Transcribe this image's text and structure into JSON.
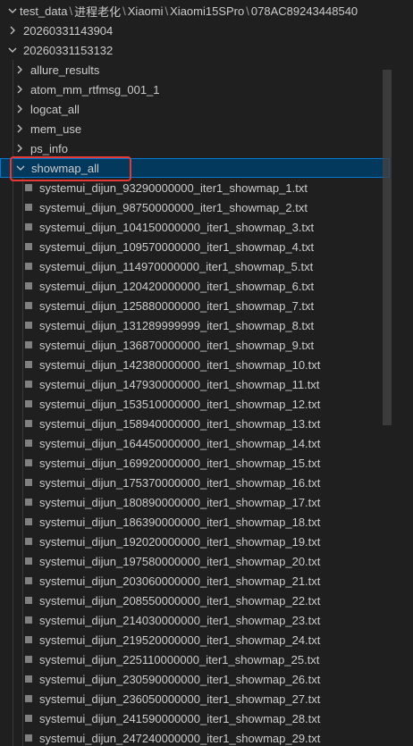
{
  "breadcrumb": {
    "segments": [
      "test_data",
      "进程老化",
      "Xiaomi",
      "Xiaomi15SPro",
      "078AC89243448540"
    ]
  },
  "tree": {
    "folders_level1": [
      {
        "name": "20260331143904",
        "expanded": false
      },
      {
        "name": "20260331153132",
        "expanded": true
      }
    ],
    "folders_level2": [
      {
        "name": "allure_results",
        "expanded": false
      },
      {
        "name": "atom_mm_rtfmsg_001_1",
        "expanded": false
      },
      {
        "name": "logcat_all",
        "expanded": false
      },
      {
        "name": "mem_use",
        "expanded": false
      },
      {
        "name": "ps_info",
        "expanded": false
      },
      {
        "name": "showmap_all",
        "expanded": true,
        "selected": true
      }
    ],
    "files": [
      "systemui_dijun_93290000000_iter1_showmap_1.txt",
      "systemui_dijun_98750000000_iter1_showmap_2.txt",
      "systemui_dijun_104150000000_iter1_showmap_3.txt",
      "systemui_dijun_109570000000_iter1_showmap_4.txt",
      "systemui_dijun_114970000000_iter1_showmap_5.txt",
      "systemui_dijun_120420000000_iter1_showmap_6.txt",
      "systemui_dijun_125880000000_iter1_showmap_7.txt",
      "systemui_dijun_131289999999_iter1_showmap_8.txt",
      "systemui_dijun_136870000000_iter1_showmap_9.txt",
      "systemui_dijun_142380000000_iter1_showmap_10.txt",
      "systemui_dijun_147930000000_iter1_showmap_11.txt",
      "systemui_dijun_153510000000_iter1_showmap_12.txt",
      "systemui_dijun_158940000000_iter1_showmap_13.txt",
      "systemui_dijun_164450000000_iter1_showmap_14.txt",
      "systemui_dijun_169920000000_iter1_showmap_15.txt",
      "systemui_dijun_175370000000_iter1_showmap_16.txt",
      "systemui_dijun_180890000000_iter1_showmap_17.txt",
      "systemui_dijun_186390000000_iter1_showmap_18.txt",
      "systemui_dijun_192020000000_iter1_showmap_19.txt",
      "systemui_dijun_197580000000_iter1_showmap_20.txt",
      "systemui_dijun_203060000000_iter1_showmap_21.txt",
      "systemui_dijun_208550000000_iter1_showmap_22.txt",
      "systemui_dijun_214030000000_iter1_showmap_23.txt",
      "systemui_dijun_219520000000_iter1_showmap_24.txt",
      "systemui_dijun_225110000000_iter1_showmap_25.txt",
      "systemui_dijun_230590000000_iter1_showmap_26.txt",
      "systemui_dijun_236050000000_iter1_showmap_27.txt",
      "systemui_dijun_241590000000_iter1_showmap_28.txt",
      "systemui_dijun_247240000000_iter1_showmap_29.txt"
    ]
  },
  "icons": {
    "chevron_collapsed": "chevron-right-icon",
    "chevron_expanded": "chevron-down-icon",
    "file": "text-file-icon"
  },
  "colors": {
    "background": "#1f1f1f",
    "selected_background": "#04395e",
    "selected_border": "#0078d4",
    "annotation_box": "#e53935"
  }
}
